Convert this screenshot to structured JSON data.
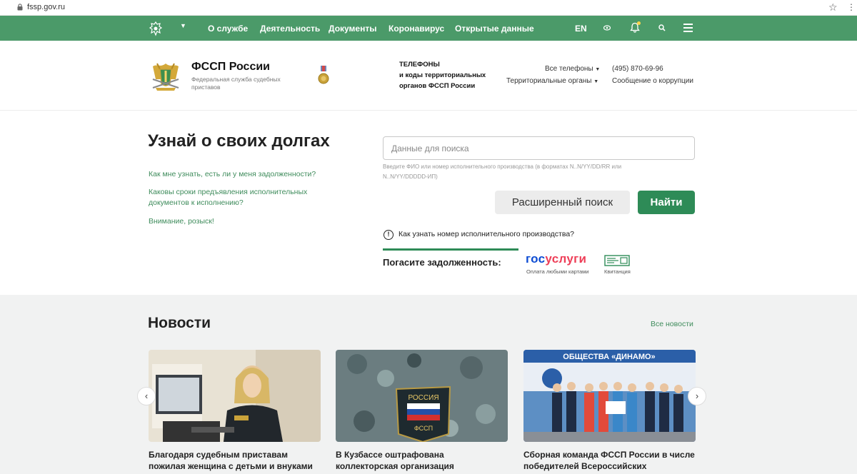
{
  "browser": {
    "url": "fssp.gov.ru"
  },
  "topnav": {
    "links": [
      "О службе",
      "Деятельность",
      "Документы",
      "Коронавирус",
      "Открытые данные"
    ],
    "lang": "EN"
  },
  "header": {
    "title": "ФССП России",
    "subtitle": "Федеральная служба судебных приставов",
    "phones_line1": "ТЕЛЕФОНЫ",
    "phones_line2": "и коды территориальных",
    "phones_line3": "органов ФССП России",
    "all_phones": "Все телефоны",
    "regional": "Территориальные органы",
    "phone_number": "(495) 870-69-96",
    "corruption": "Сообщение о коррупции"
  },
  "search": {
    "title": "Узнай о своих долгах",
    "faq": [
      "Как мне узнать, есть ли у меня задолженности?",
      "Каковы сроки предъявления исполнительных документов к исполнению?",
      "Внимание, розыск!"
    ],
    "placeholder": "Данные для поиска",
    "hint": "Введите ФИО или номер исполнительного производства (в форматах N..N/YY/DD/RR или N..N/YY/DDDDD-ИП)",
    "advanced_label": "Расширенный поиск",
    "find_label": "Найти",
    "help_link": "Как узнать номер исполнительного производства?",
    "pay_label": "Погасите задолженность:",
    "gos_part1": "гос",
    "gos_part2": "услуги",
    "gos_caption": "Оплата любыми картами",
    "receipt_caption": "Квитанция"
  },
  "news": {
    "title": "Новости",
    "all_news": "Все новости",
    "cards": [
      {
        "headline": "Благодаря судебным приставам пожилая женщина с детьми и внуками получила"
      },
      {
        "headline": "В Кузбассе оштрафована коллекторская организация"
      },
      {
        "headline": "Сборная команда ФССП России в числе победителей Всероссийских"
      }
    ],
    "card3_banner": "ОБЩЕСТВА «ДИНАМО»",
    "card2_patch_top": "РОССИЯ",
    "card2_patch_bottom": "ФССП"
  },
  "colors": {
    "nav_green": "#4b9a69",
    "accent_green": "#2e8b57",
    "link_green": "#3f8c5c"
  }
}
